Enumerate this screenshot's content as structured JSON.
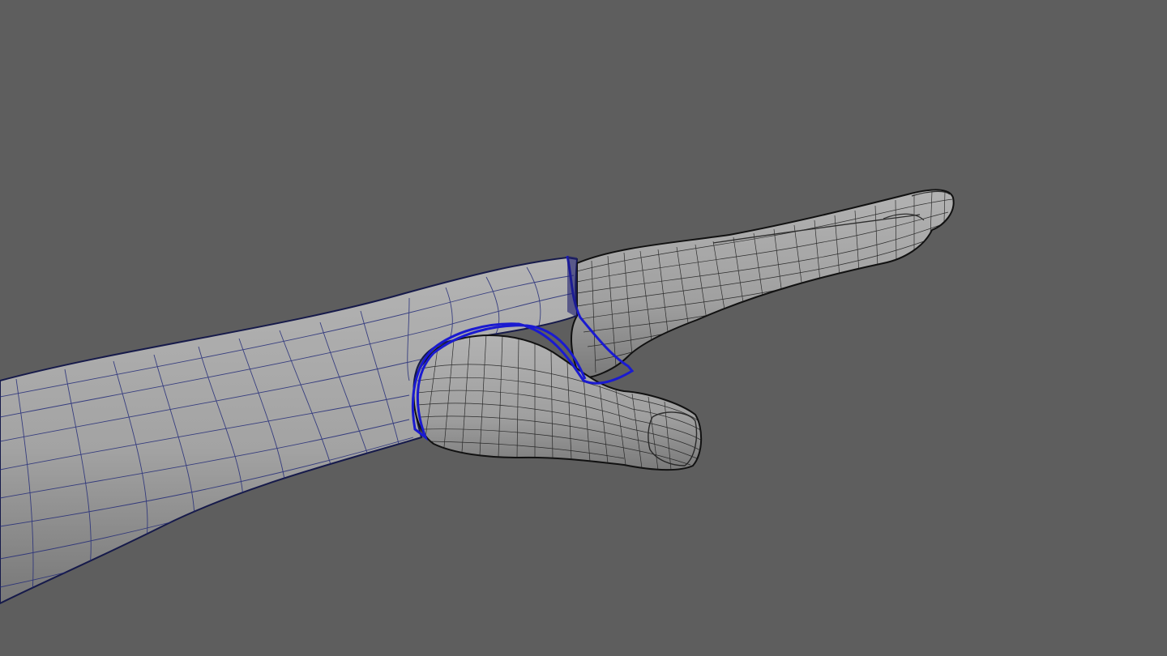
{
  "viewport": {
    "background": "#5e5e5e"
  },
  "model": {
    "arm": {
      "fill": "#a6a6a6",
      "wire": "#232b78",
      "outline": "#161a4a"
    },
    "glove": {
      "fill": "#a2a2a2",
      "wire": "#181818",
      "outline": "#111111",
      "rim": "#1a1ad0"
    }
  }
}
